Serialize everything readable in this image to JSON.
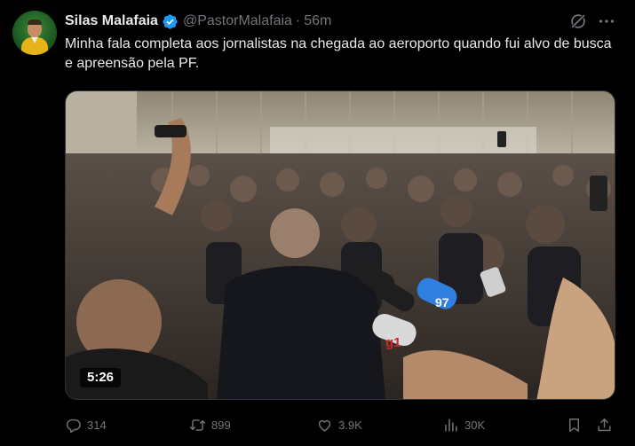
{
  "author": {
    "name": "Silas Malafaia",
    "handle": "@PastorMalafaia",
    "separator": "·",
    "time": "56m",
    "verified": true
  },
  "tweet": {
    "text": "Minha fala completa aos jornalistas na chegada ao aeroporto quando fui alvo de busca e apreensão pela PF."
  },
  "video": {
    "duration": "5:26",
    "mic_labels": [
      "97",
      "g1"
    ]
  },
  "actions": {
    "replies": "314",
    "reposts": "899",
    "likes": "3.9K",
    "views": "30K"
  },
  "colors": {
    "background": "#000000",
    "text": "#e7e9ea",
    "muted": "#71767b",
    "verified": "#1d9bf0",
    "avatar_bg": "#2e7d32"
  },
  "icons": [
    "grok-icon",
    "more-icon",
    "reply-icon",
    "repost-icon",
    "like-icon",
    "views-icon",
    "bookmark-icon",
    "share-icon"
  ]
}
